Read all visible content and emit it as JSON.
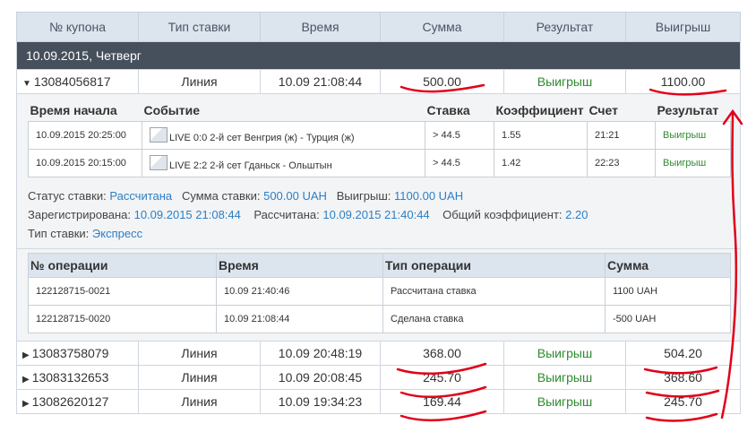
{
  "headers": [
    "№ купона",
    "Тип ставки",
    "Время",
    "Сумма",
    "Результат",
    "Выигрыш"
  ],
  "date_label": "10.09.2015, Четверг",
  "expanded": {
    "coupon": "13084056817",
    "type": "Линия",
    "time": "10.09 21:08:44",
    "sum": "500.00",
    "result": "Выигрыш",
    "win": "1100.00",
    "events_headers": [
      "Время начала",
      "Событие",
      "Ставка",
      "Коэффициент",
      "Счет",
      "Результат"
    ],
    "events": [
      {
        "start": "10.09.2015 20:25:00",
        "event": "LIVE 0:0 2-й сет Венгрия (ж) - Турция (ж)",
        "stake": "> 44.5",
        "coef": "1.55",
        "score": "21:21",
        "result": "Выигрыш"
      },
      {
        "start": "10.09.2015 20:15:00",
        "event": "LIVE 2:2 2-й сет Гданьск - Ольштын",
        "stake": "> 44.5",
        "coef": "1.42",
        "score": "22:23",
        "result": "Выигрыш"
      }
    ],
    "info": {
      "status_label": "Статус ставки:",
      "status": "Рассчитана",
      "stake_label": "Сумма ставки:",
      "stake": "500.00 UAH",
      "win_label": "Выигрыш:",
      "win": "1100.00 UAH",
      "registered_label": "Зарегистрирована:",
      "registered": "10.09.2015 21:08:44",
      "calculated_label": "Рассчитана:",
      "calculated": "10.09.2015 21:40:44",
      "total_coef_label": "Общий коэффициент:",
      "total_coef": "2.20",
      "bet_type_label": "Тип ставки:",
      "bet_type": "Экспресс"
    },
    "ops_headers": [
      "№ операции",
      "Время",
      "Тип операции",
      "Сумма"
    ],
    "ops": [
      {
        "id": "122128715-0021",
        "time": "10.09 21:40:46",
        "type": "Рассчитана ставка",
        "sum": "1100 UAH"
      },
      {
        "id": "122128715-0020",
        "time": "10.09 21:08:44",
        "type": "Сделана ставка",
        "sum": "-500 UAH"
      }
    ]
  },
  "rows": [
    {
      "coupon": "13083758079",
      "type": "Линия",
      "time": "10.09 20:48:19",
      "sum": "368.00",
      "result": "Выигрыш",
      "win": "504.20"
    },
    {
      "coupon": "13083132653",
      "type": "Линия",
      "time": "10.09 20:08:45",
      "sum": "245.70",
      "result": "Выигрыш",
      "win": "368.60"
    },
    {
      "coupon": "13082620127",
      "type": "Линия",
      "time": "10.09 19:34:23",
      "sum": "169.44",
      "result": "Выигрыш",
      "win": "245.70"
    }
  ],
  "colors": {
    "header_bg": "#dce4ee",
    "date_bar": "#46505c",
    "win_text": "#2e8b2e",
    "link": "#2b7fc4",
    "annotation": "#e0001a"
  },
  "icons": {
    "collapsed": "caret-right-icon",
    "expanded": "caret-down-icon"
  }
}
